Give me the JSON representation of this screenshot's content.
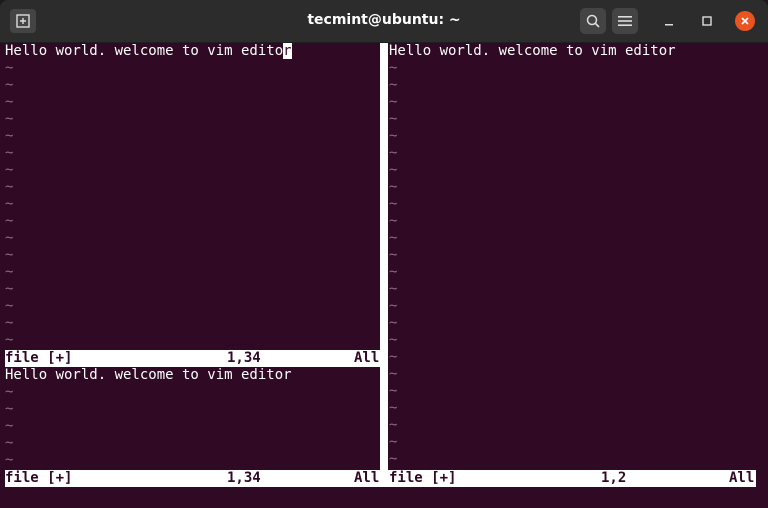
{
  "window": {
    "title": "tecmint@ubuntu: ~"
  },
  "icons": {
    "new_tab": "new-tab-icon",
    "search": "search-icon",
    "menu": "hamburger-menu-icon",
    "minimize": "minimize-icon",
    "maximize": "maximize-icon",
    "close": "close-icon"
  },
  "colors": {
    "terminal_bg": "#300a24",
    "close_button": "#e95420",
    "titlebar_bg": "#2c2c2c"
  },
  "top_left_pane": {
    "text_before_cursor": "Hello world. welcome to vim edito",
    "cursor_char": "r",
    "tilde": "~",
    "status": {
      "file": "file [+]",
      "position": "1,34",
      "scroll": "All"
    }
  },
  "bottom_left_pane": {
    "text": "Hello world. welcome to vim editor",
    "tilde": "~",
    "status": {
      "file": "file [+]",
      "position": "1,34",
      "scroll": "All"
    }
  },
  "right_pane": {
    "text": "Hello world. welcome to vim editor",
    "tilde": "~",
    "status": {
      "file": "file [+]",
      "position": "1,2",
      "scroll": "All"
    }
  }
}
